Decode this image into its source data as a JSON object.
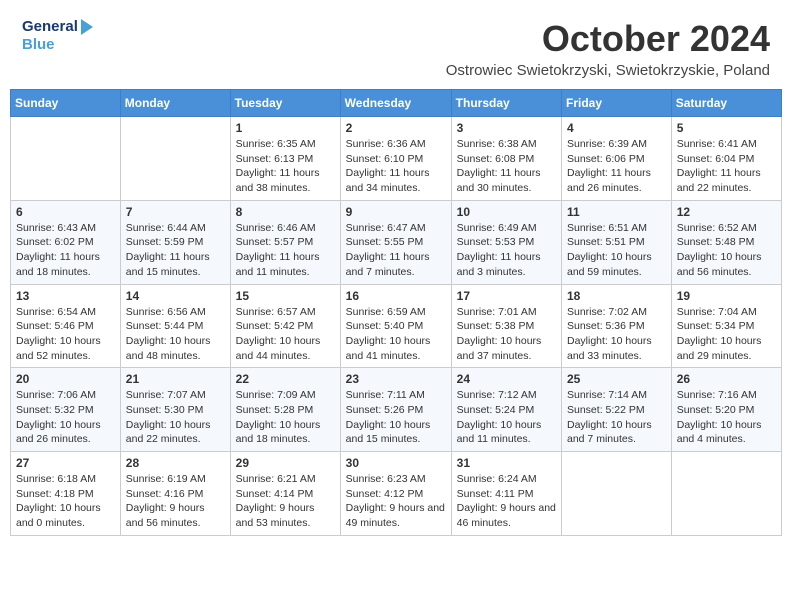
{
  "logo": {
    "general": "General",
    "blue": "Blue"
  },
  "title": "October 2024",
  "subtitle": "Ostrowiec Swietokrzyski, Swietokrzyskie, Poland",
  "days_of_week": [
    "Sunday",
    "Monday",
    "Tuesday",
    "Wednesday",
    "Thursday",
    "Friday",
    "Saturday"
  ],
  "weeks": [
    [
      {
        "day": "",
        "info": ""
      },
      {
        "day": "",
        "info": ""
      },
      {
        "day": "1",
        "info": "Sunrise: 6:35 AM\nSunset: 6:13 PM\nDaylight: 11 hours and 38 minutes."
      },
      {
        "day": "2",
        "info": "Sunrise: 6:36 AM\nSunset: 6:10 PM\nDaylight: 11 hours and 34 minutes."
      },
      {
        "day": "3",
        "info": "Sunrise: 6:38 AM\nSunset: 6:08 PM\nDaylight: 11 hours and 30 minutes."
      },
      {
        "day": "4",
        "info": "Sunrise: 6:39 AM\nSunset: 6:06 PM\nDaylight: 11 hours and 26 minutes."
      },
      {
        "day": "5",
        "info": "Sunrise: 6:41 AM\nSunset: 6:04 PM\nDaylight: 11 hours and 22 minutes."
      }
    ],
    [
      {
        "day": "6",
        "info": "Sunrise: 6:43 AM\nSunset: 6:02 PM\nDaylight: 11 hours and 18 minutes."
      },
      {
        "day": "7",
        "info": "Sunrise: 6:44 AM\nSunset: 5:59 PM\nDaylight: 11 hours and 15 minutes."
      },
      {
        "day": "8",
        "info": "Sunrise: 6:46 AM\nSunset: 5:57 PM\nDaylight: 11 hours and 11 minutes."
      },
      {
        "day": "9",
        "info": "Sunrise: 6:47 AM\nSunset: 5:55 PM\nDaylight: 11 hours and 7 minutes."
      },
      {
        "day": "10",
        "info": "Sunrise: 6:49 AM\nSunset: 5:53 PM\nDaylight: 11 hours and 3 minutes."
      },
      {
        "day": "11",
        "info": "Sunrise: 6:51 AM\nSunset: 5:51 PM\nDaylight: 10 hours and 59 minutes."
      },
      {
        "day": "12",
        "info": "Sunrise: 6:52 AM\nSunset: 5:48 PM\nDaylight: 10 hours and 56 minutes."
      }
    ],
    [
      {
        "day": "13",
        "info": "Sunrise: 6:54 AM\nSunset: 5:46 PM\nDaylight: 10 hours and 52 minutes."
      },
      {
        "day": "14",
        "info": "Sunrise: 6:56 AM\nSunset: 5:44 PM\nDaylight: 10 hours and 48 minutes."
      },
      {
        "day": "15",
        "info": "Sunrise: 6:57 AM\nSunset: 5:42 PM\nDaylight: 10 hours and 44 minutes."
      },
      {
        "day": "16",
        "info": "Sunrise: 6:59 AM\nSunset: 5:40 PM\nDaylight: 10 hours and 41 minutes."
      },
      {
        "day": "17",
        "info": "Sunrise: 7:01 AM\nSunset: 5:38 PM\nDaylight: 10 hours and 37 minutes."
      },
      {
        "day": "18",
        "info": "Sunrise: 7:02 AM\nSunset: 5:36 PM\nDaylight: 10 hours and 33 minutes."
      },
      {
        "day": "19",
        "info": "Sunrise: 7:04 AM\nSunset: 5:34 PM\nDaylight: 10 hours and 29 minutes."
      }
    ],
    [
      {
        "day": "20",
        "info": "Sunrise: 7:06 AM\nSunset: 5:32 PM\nDaylight: 10 hours and 26 minutes."
      },
      {
        "day": "21",
        "info": "Sunrise: 7:07 AM\nSunset: 5:30 PM\nDaylight: 10 hours and 22 minutes."
      },
      {
        "day": "22",
        "info": "Sunrise: 7:09 AM\nSunset: 5:28 PM\nDaylight: 10 hours and 18 minutes."
      },
      {
        "day": "23",
        "info": "Sunrise: 7:11 AM\nSunset: 5:26 PM\nDaylight: 10 hours and 15 minutes."
      },
      {
        "day": "24",
        "info": "Sunrise: 7:12 AM\nSunset: 5:24 PM\nDaylight: 10 hours and 11 minutes."
      },
      {
        "day": "25",
        "info": "Sunrise: 7:14 AM\nSunset: 5:22 PM\nDaylight: 10 hours and 7 minutes."
      },
      {
        "day": "26",
        "info": "Sunrise: 7:16 AM\nSunset: 5:20 PM\nDaylight: 10 hours and 4 minutes."
      }
    ],
    [
      {
        "day": "27",
        "info": "Sunrise: 6:18 AM\nSunset: 4:18 PM\nDaylight: 10 hours and 0 minutes."
      },
      {
        "day": "28",
        "info": "Sunrise: 6:19 AM\nSunset: 4:16 PM\nDaylight: 9 hours and 56 minutes."
      },
      {
        "day": "29",
        "info": "Sunrise: 6:21 AM\nSunset: 4:14 PM\nDaylight: 9 hours and 53 minutes."
      },
      {
        "day": "30",
        "info": "Sunrise: 6:23 AM\nSunset: 4:12 PM\nDaylight: 9 hours and 49 minutes."
      },
      {
        "day": "31",
        "info": "Sunrise: 6:24 AM\nSunset: 4:11 PM\nDaylight: 9 hours and 46 minutes."
      },
      {
        "day": "",
        "info": ""
      },
      {
        "day": "",
        "info": ""
      }
    ]
  ]
}
